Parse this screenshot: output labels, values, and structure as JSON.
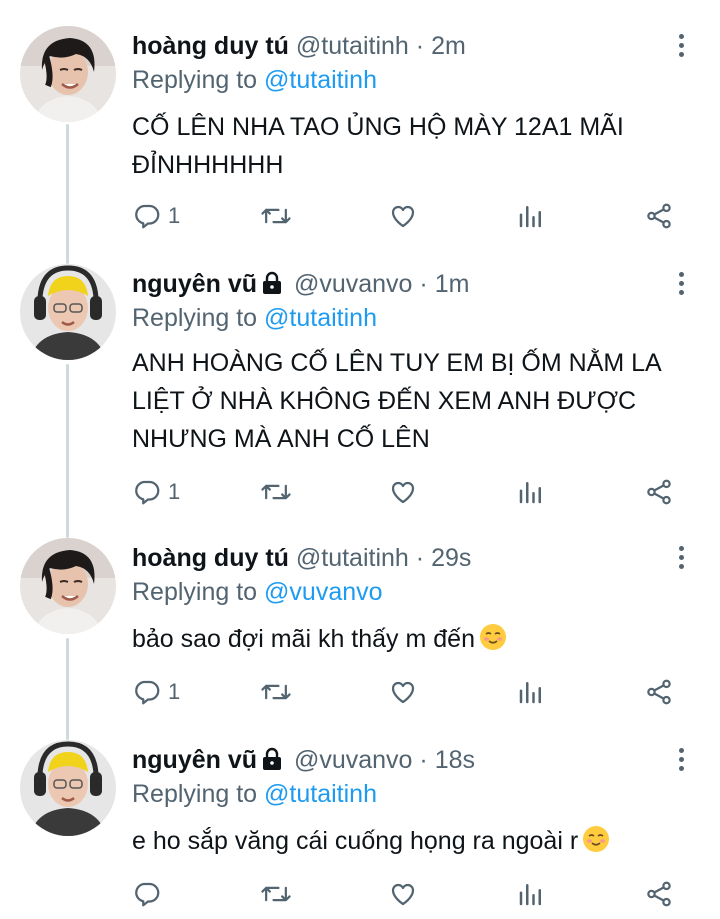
{
  "tweets": [
    {
      "name": "hoàng duy tú",
      "handle": "@tutaitinh",
      "separator": "·",
      "time": "2m",
      "replying_prefix": "Replying to",
      "replying_to": "@tutaitinh",
      "text": "CỐ LÊN NHA TAO ỦNG HỘ MÀY 12A1 MÃI ĐỈNHHHHHH",
      "reply_count": "1",
      "locked": false,
      "avatar": "avatar-tu"
    },
    {
      "name": "nguyên vũ",
      "handle": "@vuvanvo",
      "separator": "·",
      "time": "1m",
      "replying_prefix": "Replying to",
      "replying_to": "@tutaitinh",
      "text": "ANH HOÀNG CỐ LÊN TUY EM BỊ ỐM NẰM LA LIỆT Ở NHÀ KHÔNG ĐẾN XEM ANH ĐƯỢC NHƯNG MÀ ANH CỐ LÊN",
      "reply_count": "1",
      "locked": true,
      "avatar": "avatar-vu"
    },
    {
      "name": "hoàng duy tú",
      "handle": "@tutaitinh",
      "separator": "·",
      "time": "29s",
      "replying_prefix": "Replying to",
      "replying_to": "@vuvanvo",
      "text": "bảo sao đợi mãi kh thấy m đến",
      "emoji": "smiling-face-emoji",
      "reply_count": "1",
      "locked": false,
      "avatar": "avatar-tu"
    },
    {
      "name": "nguyên vũ",
      "handle": "@vuvanvo",
      "separator": "·",
      "time": "18s",
      "replying_prefix": "Replying to",
      "replying_to": "@tutaitinh",
      "text": "e ho sắp văng cái cuống họng ra ngoài r",
      "emoji": "smiling-face-emoji",
      "reply_count": "",
      "locked": true,
      "avatar": "avatar-vu"
    }
  ],
  "icons": {
    "reply": "reply-icon",
    "retweet": "retweet-icon",
    "like": "heart-icon",
    "views": "views-icon",
    "share": "share-icon",
    "more": "more-vertical-icon",
    "lock": "lock-icon"
  },
  "colors": {
    "text": "#0f1419",
    "secondary": "#536471",
    "mention": "#1d9bf0",
    "thread_line": "#cfd9de"
  }
}
